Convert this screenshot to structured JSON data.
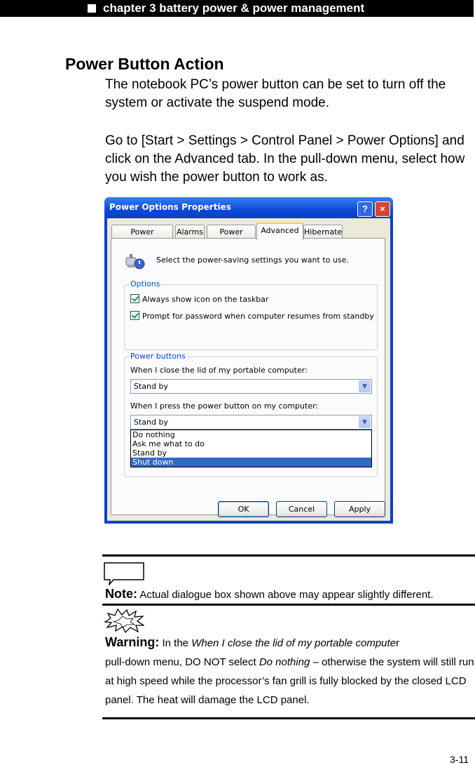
{
  "header": {
    "chapter": "chapter 3 battery power & power management"
  },
  "section": {
    "title": "Power Button Action",
    "para1": "The notebook PC’s power button can be set to turn off the system or activate the suspend mode.",
    "para2": "Go to [Start > Settings > Control Panel > Power Options] and click on the Advanced tab. In the pull-down menu, select how you wish the power button to work as."
  },
  "dialog": {
    "title": "Power Options Properties",
    "help": "?",
    "close": "×",
    "tabs": [
      "Power Schemes",
      "Alarms",
      "Power Meter",
      "Advanced",
      "Hibernate"
    ],
    "active_tab": "Advanced",
    "intro": "Select the power-saving settings you want to use.",
    "options_group": "Options",
    "option1": "Always show icon on the taskbar",
    "option2": "Prompt for password when computer resumes from standby",
    "power_group": "Power buttons",
    "lid_label": "When I close the lid of my portable computer:",
    "lid_value": "Stand by",
    "button_label": "When I press the power button on my computer:",
    "button_value": "Stand by",
    "dropdown_options": [
      "Do nothing",
      "Ask me what to do",
      "Stand by",
      "Shut down"
    ],
    "dropdown_selected": "Shut down",
    "ok": "OK",
    "cancel": "Cancel",
    "apply": "Apply",
    "accent_color": "#0a3fd0"
  },
  "note": {
    "label": "Note:",
    "text": "Actual dialogue box shown above may appear slightly different."
  },
  "warning": {
    "label": "Warning:",
    "t1": "In the ",
    "t2": "When I close the lid of my portable compute",
    "t3": "r",
    "t4": "pull-down menu, DO NOT select ",
    "t5": "Do nothing",
    "t6": " – otherwise the system will still run at high speed while the processor’s fan grill is fully blocked by the closed LCD panel. The heat will damage the LCD panel."
  },
  "page_number": "3-11"
}
